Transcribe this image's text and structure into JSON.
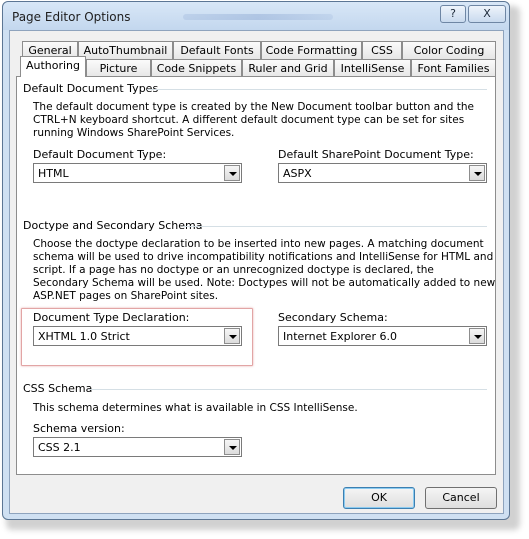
{
  "window": {
    "title": "Page Editor Options",
    "help_label": "?",
    "close_label": "X"
  },
  "tabs": {
    "row1": [
      "General",
      "AutoThumbnail",
      "Default Fonts",
      "Code Formatting",
      "CSS",
      "Color Coding"
    ],
    "row2": [
      "Authoring",
      "Picture",
      "Code Snippets",
      "Ruler and Grid",
      "IntelliSense",
      "Font Families"
    ],
    "active": "Authoring"
  },
  "default_types": {
    "title": "Default Document Types",
    "description": [
      "The default document type is created by the New Document toolbar button and the",
      "CTRL+N keyboard shortcut. A different default document type can be set for sites",
      "running Windows SharePoint Services."
    ],
    "doc_type_label": "Default Document Type:",
    "doc_type_value": "HTML",
    "sp_type_label": "Default SharePoint Document Type:",
    "sp_type_value": "ASPX"
  },
  "doctype": {
    "title": "Doctype and Secondary Schema",
    "description": [
      "Choose the doctype declaration to be inserted into new pages. A matching document",
      "schema will be used to drive incompatibility notifications and IntelliSense for HTML and",
      "script. If a page has no doctype or an unrecognized doctype is declared, the",
      "Secondary Schema will be used. Note: Doctypes will not be automatically added to new",
      "ASP.NET pages on SharePoint sites."
    ],
    "declaration_label": "Document Type Declaration:",
    "declaration_value": "XHTML 1.0 Strict",
    "schema_label": "Secondary Schema:",
    "schema_value": "Internet Explorer 6.0"
  },
  "css_schema": {
    "title": "CSS Schema",
    "description": "This schema determines what is available in CSS IntelliSense.",
    "version_label": "Schema version:",
    "version_value": "CSS 2.1"
  },
  "buttons": {
    "ok": "OK",
    "cancel": "Cancel"
  }
}
